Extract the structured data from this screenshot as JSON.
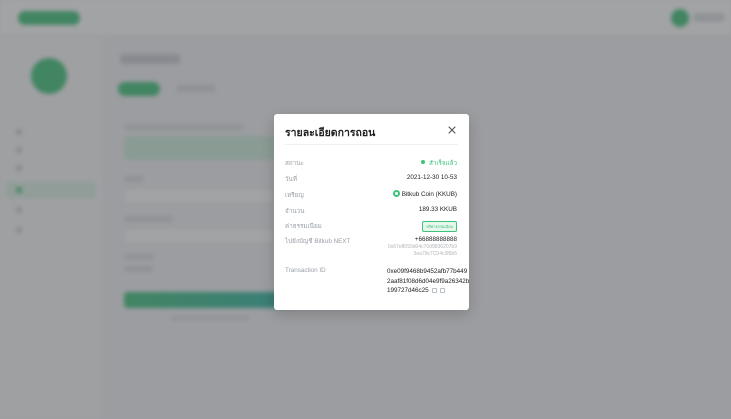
{
  "modal": {
    "title": "รายละเอียดการถอน",
    "rows": [
      {
        "label": "สถานะ",
        "value": "สำเร็จแล้ว"
      },
      {
        "label": "วันที่",
        "value": "2021-12-30 10-53"
      },
      {
        "label": "เหรียญ",
        "value": "Bitkub Coin (KKUB)"
      },
      {
        "label": "จำนวน",
        "value": "189.33 KKUB"
      },
      {
        "label": "ค่าธรรมเนียม",
        "value": "ฟรีค่าธรรมเนียม"
      },
      {
        "label": "ไปยังบัญชี Bitkub NEXT",
        "value": "+66888888888",
        "address_line1": "0x67e8093d04c70d9836207b9",
        "address_line2": "3ea79c7C04c3f6b5"
      },
      {
        "label": "Transaction ID",
        "value": "0xe09f9468b9452afb77b4492aaf81f08d6d04e9f9a26342b199727d46c25"
      }
    ]
  },
  "icons": {
    "close": "close-icon",
    "status": "status-dot-icon",
    "coin": "bitkub-coin-icon",
    "external_link": "external-link-icon",
    "copy": "copy-icon"
  },
  "colors": {
    "accent": "#3ec37a",
    "overlay": "#46484c"
  }
}
